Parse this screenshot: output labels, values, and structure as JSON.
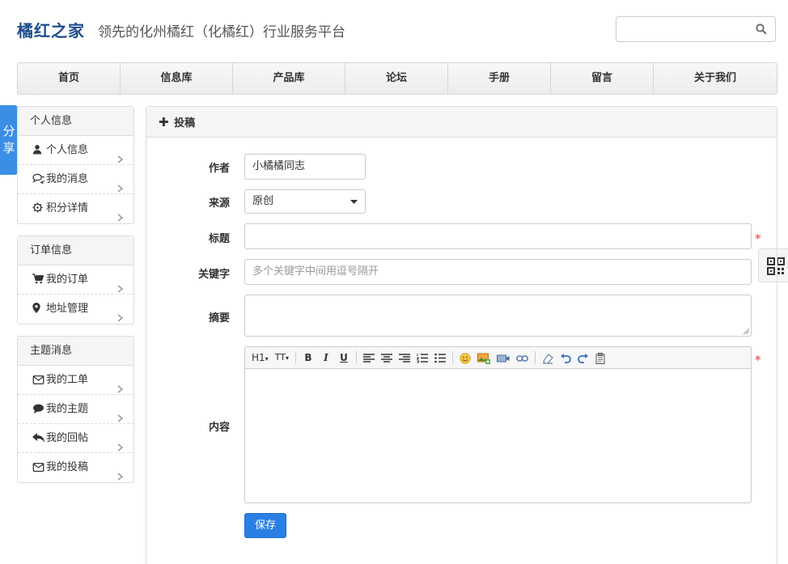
{
  "header": {
    "logo": "橘红之家",
    "slogan": "领先的化州橘红（化橘红）行业服务平台",
    "search_value": ""
  },
  "nav": [
    {
      "label": "首页",
      "w": 127
    },
    {
      "label": "信息库",
      "w": 139
    },
    {
      "label": "产品库",
      "w": 139
    },
    {
      "label": "论坛",
      "w": 127
    },
    {
      "label": "手册",
      "w": 127
    },
    {
      "label": "留言",
      "w": 127
    },
    {
      "label": "关于我们",
      "w": 152
    }
  ],
  "share_label": "分享",
  "sidebar": {
    "personal": {
      "title": "个人信息",
      "items": [
        {
          "label": "个人信息",
          "icon": "user-icon"
        },
        {
          "label": "我的消息",
          "icon": "comments-icon"
        },
        {
          "label": "积分详情",
          "icon": "gear-icon"
        }
      ]
    },
    "orders": {
      "title": "订单信息",
      "items": [
        {
          "label": "我的订单",
          "icon": "cart-icon"
        },
        {
          "label": "地址管理",
          "icon": "map-marker-icon"
        }
      ]
    },
    "topics": {
      "title": "主题消息",
      "items": [
        {
          "label": "我的工单",
          "icon": "envelope-icon"
        },
        {
          "label": "我的主题",
          "icon": "comment-icon"
        },
        {
          "label": "我的回帖",
          "icon": "reply-icon"
        },
        {
          "label": "我的投稿",
          "icon": "envelope-icon"
        }
      ]
    }
  },
  "form": {
    "header": "投稿",
    "author_label": "作者",
    "author_value": "小橘橘同志",
    "source_label": "来源",
    "source_value": "原创",
    "title_label": "标题",
    "title_value": "",
    "keywords_label": "关键字",
    "keywords_placeholder": "多个关键字中间用逗号隔开",
    "summary_label": "摘要",
    "content_label": "内容",
    "required_mark": "*",
    "save_label": "保存",
    "toolbar": {
      "heading": "H1",
      "font_size": "TT"
    }
  },
  "colors": {
    "brand": "#1f4e8c",
    "accent": "#2a7fe5",
    "required": "#e33333"
  }
}
